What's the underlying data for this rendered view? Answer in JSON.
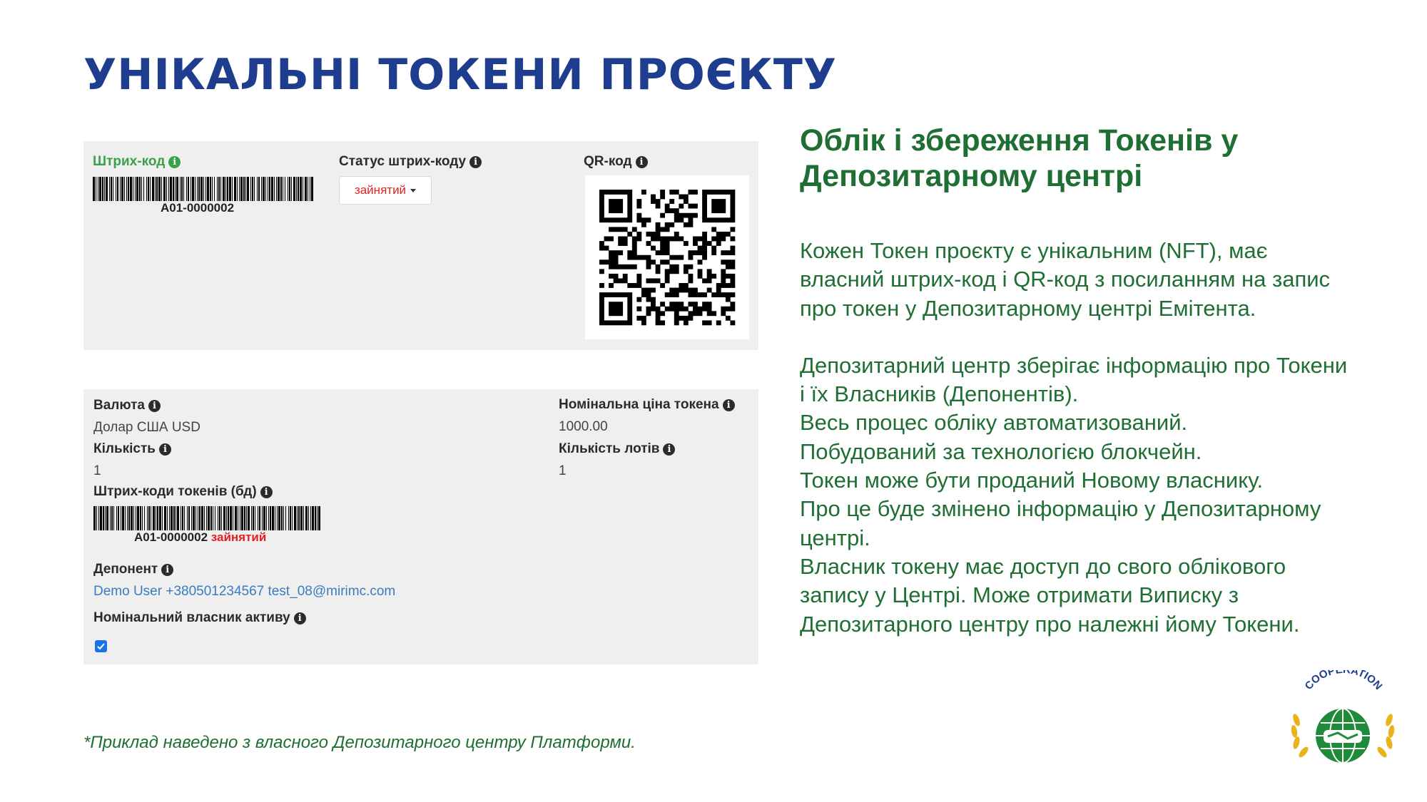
{
  "slide": {
    "title": "УНІКАЛЬНІ ТОКЕНИ ПРОЄКТУ",
    "footnote": "*Приклад наведено з власного Депозитарного центру Платформи."
  },
  "panel_top": {
    "barcode_label": "Штрих-код",
    "barcode_value": "A01-0000002",
    "status_label": "Статус штрих-коду",
    "status_value": "зайнятий",
    "qr_label": "QR-код"
  },
  "panel_bottom": {
    "currency_label": "Валюта",
    "currency_value": "Долар США USD",
    "quantity_label": "Кількість",
    "quantity_value": "1",
    "token_barcodes_label": "Штрих-коди токенів (бд)",
    "token_barcode_value": "A01-0000002",
    "token_barcode_status": "зайнятий",
    "depositor_label": "Депонент",
    "depositor_value": "Demo User +380501234567 test_08@mirimc.com",
    "nominal_owner_label": "Номінальний власник активу",
    "nominal_owner_checked": true,
    "nominal_price_label": "Номінальна ціна токена",
    "nominal_price_value": "1000.00",
    "lots_label": "Кількість лотів",
    "lots_value": "1"
  },
  "right": {
    "heading": "Облік і збереження Токенів у Депозитарному центрі",
    "para1": "Кожен Токен проєкту є унікальним (NFT), має власний штрих-код і QR-код з посиланням на запис про токен у Депозитарному центрі Емітента.",
    "lines": [
      "Депозитарний центр зберігає інформацію про Токени і їх Власників (Депонентів).",
      "Весь процес обліку автоматизований.",
      "Побудований за технологією блокчейн.",
      "Токен може бути проданий Новому власнику.",
      "Про це буде змінено інформацію у Депозитарному центрі.",
      "Власник токену має доступ до свого облікового запису у Центрі. Може отримати Виписку з Депозитарного центру про належні йому Токени."
    ]
  },
  "logo": {
    "text": "COOPERATION"
  },
  "colors": {
    "title": "#1f3d8f",
    "body_green": "#1f6e33",
    "label_green": "#3aa04a",
    "status_red": "#e52020",
    "link_blue": "#3a7cc0",
    "panel_bg": "#efefef"
  }
}
